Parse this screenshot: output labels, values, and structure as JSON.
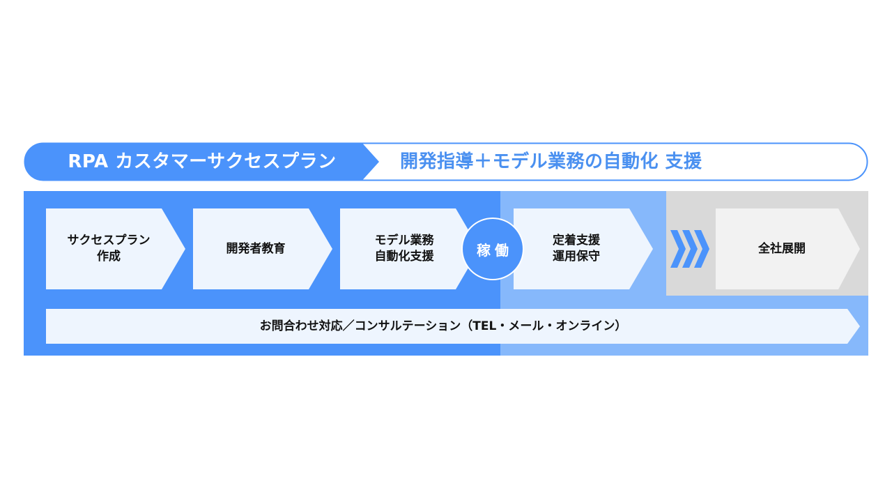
{
  "header": {
    "title": "RPA カスタマーサクセスプラン",
    "subtitle": "開発指導＋モデル業務の自動化 支援"
  },
  "steps": [
    {
      "label": "サクセスプラン\n作成"
    },
    {
      "label": "開発者教育"
    },
    {
      "label": "モデル業務\n自動化支援"
    },
    {
      "label": "定着支援\n運用保守"
    },
    {
      "label": "全社展開"
    }
  ],
  "milestone": {
    "label": "稼働"
  },
  "bottom": {
    "label": "お問合わせ対応／コンサルテーション（TEL・メール・オンライン）"
  },
  "colors": {
    "primary": "#4b93fb",
    "light": "#86b8fb",
    "gray": "#d9d9d9",
    "box": "#eef5fe"
  },
  "icons": {
    "progress": "triple-chevron-right-icon"
  }
}
